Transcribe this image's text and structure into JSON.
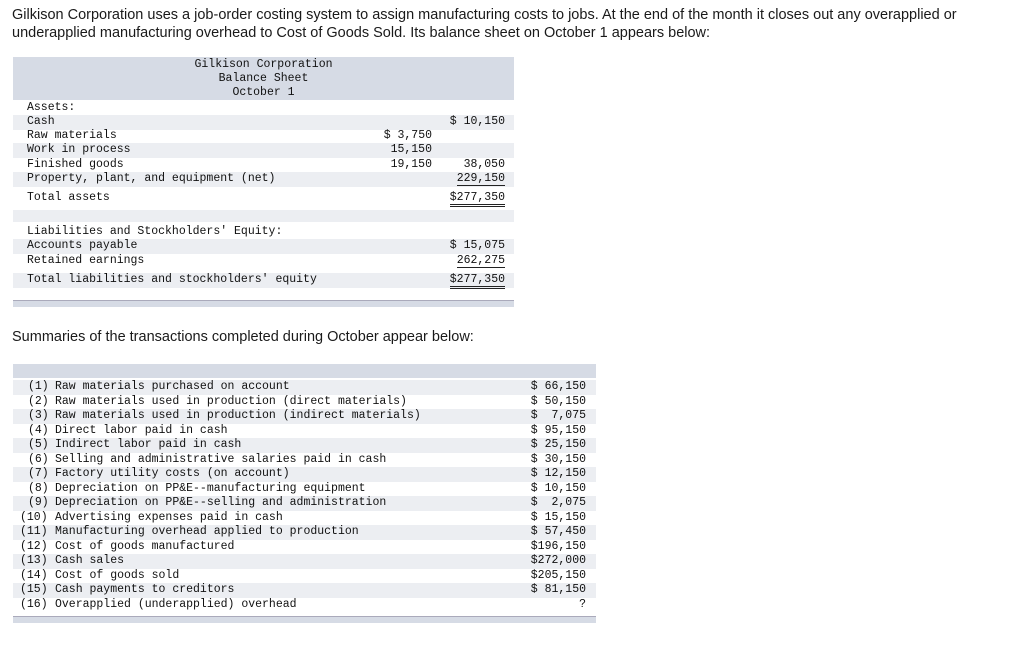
{
  "intro_text": "Gilkison Corporation uses a job-order costing system to assign manufacturing costs to jobs. At the end of the month it closes out any overapplied or underapplied manufacturing overhead to Cost of Goods Sold. Its balance sheet on October 1 appears below:",
  "balance_sheet": {
    "title_lines": [
      "Gilkison Corporation",
      "Balance Sheet",
      "October 1"
    ],
    "assets_header": "Assets:",
    "cash": {
      "label": "Cash",
      "total": "$ 10,150"
    },
    "raw_materials": {
      "label": "Raw materials",
      "amount": "$ 3,750"
    },
    "work_in_process": {
      "label": "Work in process",
      "amount": "15,150"
    },
    "finished_goods": {
      "label": "Finished goods",
      "amount": "19,150",
      "total": "38,050"
    },
    "ppe": {
      "label": "Property, plant, and equipment (net)",
      "total": "229,150"
    },
    "total_assets": {
      "label": "Total assets",
      "total": "$277,350"
    },
    "liab_header": "Liabilities and Stockholders' Equity:",
    "accounts_payable": {
      "label": "Accounts payable",
      "total": "$ 15,075"
    },
    "retained_earnings": {
      "label": "Retained earnings",
      "total": "262,275"
    },
    "total_liab": {
      "label": "Total liabilities and stockholders' equity",
      "total": "$277,350"
    }
  },
  "summary_text": "Summaries of the transactions completed during October appear below:",
  "transactions": [
    {
      "num": "(1)",
      "desc": "Raw materials purchased on account",
      "value": "$ 66,150"
    },
    {
      "num": "(2)",
      "desc": "Raw materials used in production (direct materials)",
      "value": "$ 50,150"
    },
    {
      "num": "(3)",
      "desc": "Raw materials used in production (indirect materials)",
      "value": "$  7,075"
    },
    {
      "num": "(4)",
      "desc": "Direct labor paid in cash",
      "value": "$ 95,150"
    },
    {
      "num": "(5)",
      "desc": "Indirect labor paid in cash",
      "value": "$ 25,150"
    },
    {
      "num": "(6)",
      "desc": "Selling and administrative salaries paid in cash",
      "value": "$ 30,150"
    },
    {
      "num": "(7)",
      "desc": "Factory utility costs (on account)",
      "value": "$ 12,150"
    },
    {
      "num": "(8)",
      "desc": "Depreciation on PP&E--manufacturing equipment",
      "value": "$ 10,150"
    },
    {
      "num": "(9)",
      "desc": "Depreciation on PP&E--selling and administration",
      "value": "$  2,075"
    },
    {
      "num": "(10)",
      "desc": "Advertising expenses paid in cash",
      "value": "$ 15,150"
    },
    {
      "num": "(11)",
      "desc": "Manufacturing overhead applied to production",
      "value": "$ 57,450"
    },
    {
      "num": "(12)",
      "desc": "Cost of goods manufactured",
      "value": "$196,150"
    },
    {
      "num": "(13)",
      "desc": "Cash sales",
      "value": "$272,000"
    },
    {
      "num": "(14)",
      "desc": "Cost of goods sold",
      "value": "$205,150"
    },
    {
      "num": "(15)",
      "desc": "Cash payments to creditors",
      "value": "$ 81,150"
    },
    {
      "num": "(16)",
      "desc": "Overapplied (underapplied) overhead",
      "value": "?"
    }
  ]
}
